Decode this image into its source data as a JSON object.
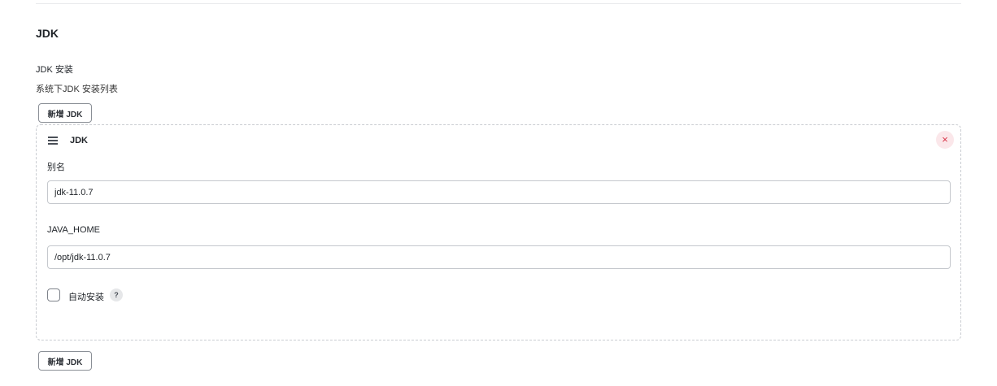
{
  "section": {
    "title": "JDK"
  },
  "installations": {
    "label": "JDK 安装",
    "description": "系统下JDK 安装列表",
    "add_button_label": "新增 JDK"
  },
  "jdk_entry": {
    "title": "JDK",
    "delete_icon": "×",
    "name_label": "别名",
    "name_value": "jdk-11.0.7",
    "java_home_label": "JAVA_HOME",
    "java_home_value": "/opt/jdk-11.0.7",
    "auto_install_label": "自动安装",
    "auto_install_checked": false,
    "help_icon": "?"
  },
  "colors": {
    "delete_accent": "#d9364a",
    "delete_background": "#fbe7ea",
    "border": "#c9ccd1"
  },
  "icons": {
    "drag_handle": "drag-handle-icon",
    "delete": "close-icon",
    "help": "help-icon"
  }
}
